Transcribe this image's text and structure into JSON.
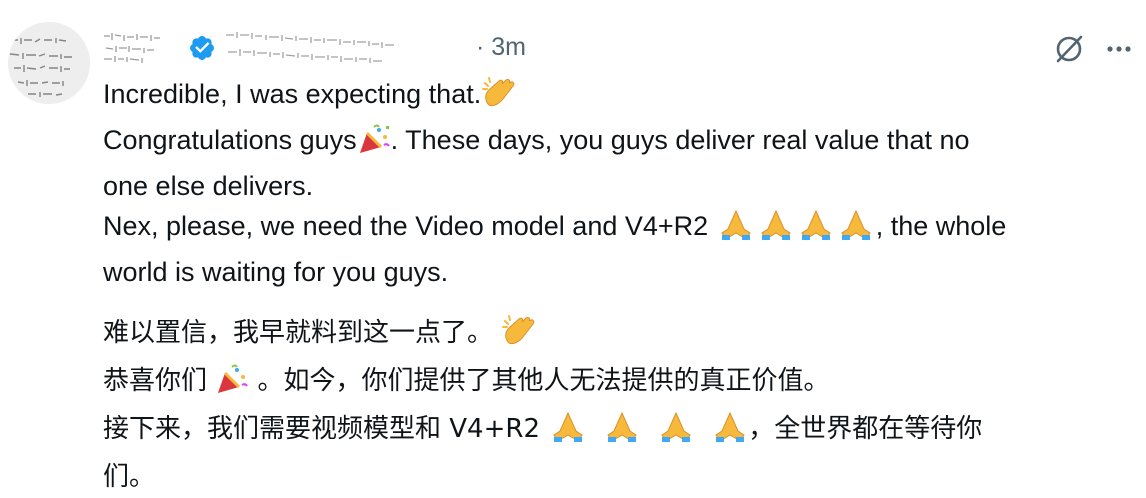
{
  "tweet": {
    "time": "· 3m",
    "icons": {
      "avatar": "avatar-image",
      "verified": "verified-badge-icon",
      "grok": "grok-icon",
      "more": "more-options-icon"
    },
    "colors": {
      "verified": "#1d9bf0",
      "text": "#0f1419",
      "secondary": "#536471"
    },
    "lines": {
      "en1": "Incredible, I was expecting that.",
      "en2a": "Congratulations guys",
      "en2b": ". These days, you guys deliver real value that no",
      "en3": "one else delivers.",
      "en4a": "Nex, please, we need the Video model and V4+R2",
      "en4b": ", the whole",
      "en5": "world is waiting for you guys.",
      "zh1": "难以置信，我早就料到这一点了。",
      "zh2a": "恭喜你们",
      "zh2b": "。如今，你们提供了其他人无法提供的真正价值。",
      "zh3a": "接下来，我们需要视频模型和 V4+R2",
      "zh3b": "，全世界都在等待你",
      "zh4": "们。"
    }
  }
}
